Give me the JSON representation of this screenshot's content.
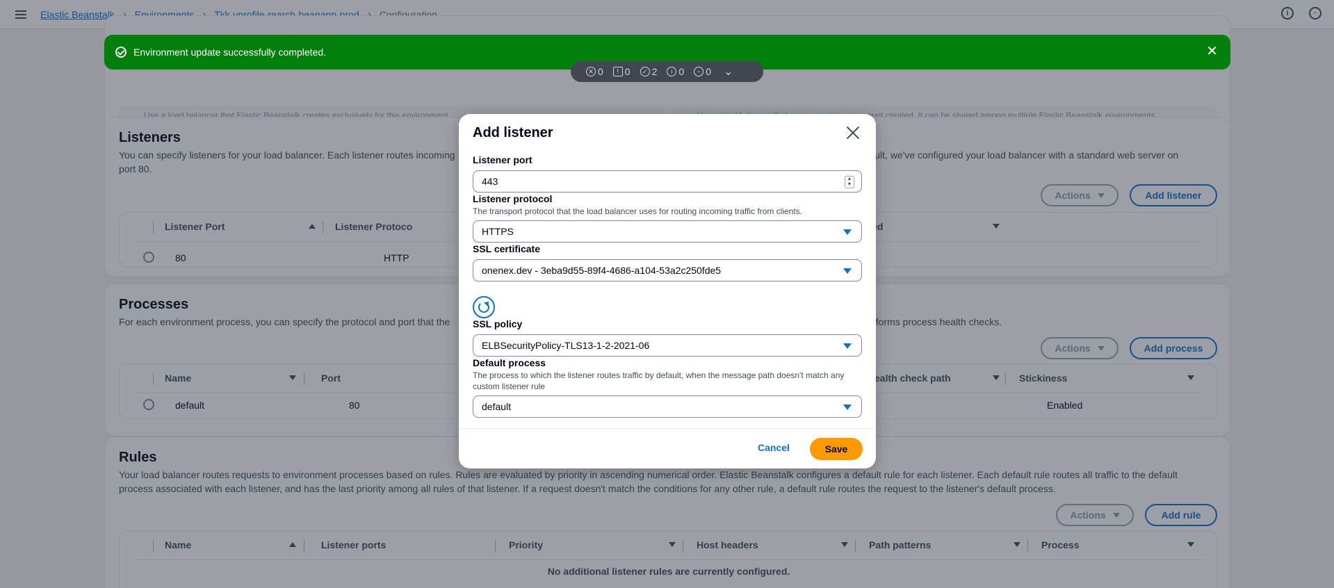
{
  "breadcrumb": {
    "items": [
      "Elastic Beanstalk",
      "Environments",
      "Tkk-vprofile-rearch-beanapp-prod"
    ],
    "current": "Configuration"
  },
  "top_icons": [
    "info-icon",
    "settings-icon"
  ],
  "load_balancer_cards": {
    "dedicated": "Use a load balancer that Elastic Beanstalk creates exclusively for this environment.",
    "shared": "Use a load balancer that someone in your account created. It can be shared among multiple Elastic Beanstalk environments."
  },
  "flash": {
    "message": "Environment update successfully completed.",
    "color": "#037f0c"
  },
  "notification_counts": [
    {
      "icon": "error-icon",
      "count": "0"
    },
    {
      "icon": "warning-icon",
      "count": "0"
    },
    {
      "icon": "success-icon",
      "count": "2"
    },
    {
      "icon": "info-icon",
      "count": "0"
    },
    {
      "icon": "in-progress-icon",
      "count": "0"
    }
  ],
  "listeners": {
    "title": "Listeners",
    "description_left": "You can specify listeners for your load balancer. Each listener routes incoming",
    "description_right": "default, we've configured your load balancer with a standard web server on",
    "description_end": "port 80.",
    "actions_label": "Actions",
    "add_label": "Add listener",
    "columns": [
      "Listener Port",
      "Listener Protoco",
      "Enabled"
    ],
    "rows": [
      {
        "port": "80",
        "protocol": "HTTP"
      }
    ]
  },
  "processes": {
    "title": "Processes",
    "description_left": "For each environment process, you can specify the protocol and port that the",
    "description_right": "r performs process health checks.",
    "actions_label": "Actions",
    "add_label": "Add process",
    "columns": [
      "Name",
      "Port",
      "ealth check path",
      "Stickiness"
    ],
    "rows": [
      {
        "name": "default",
        "port": "80",
        "stickiness": "Enabled"
      }
    ]
  },
  "rules": {
    "title": "Rules",
    "description_line1": "Your load balancer routes requests to environment processes based on rules. Rules are evaluated by priority in ascending numerical order. Elastic Beanstalk configures a default rule for each listener. Each default rule routes all traffic to the default",
    "description_line2": "process associated with each listener, and has the last priority among all rules of that listener. If a request doesn't match the conditions for any other rule, a default rule routes the request to the listener's default process.",
    "actions_label": "Actions",
    "add_label": "Add rule",
    "columns": [
      "Name",
      "Listener ports",
      "Priority",
      "Host headers",
      "Path patterns",
      "Process"
    ],
    "empty": "No additional listener rules are currently configured."
  },
  "modal": {
    "title": "Add listener",
    "listener_port": {
      "label": "Listener port",
      "value": "443"
    },
    "listener_protocol": {
      "label": "Listener protocol",
      "description": "The transport protocol that the load balancer uses for routing incoming traffic from clients.",
      "value": "HTTPS"
    },
    "ssl_certificate": {
      "label": "SSL certificate",
      "value": "onenex.dev - 3eba9d55-89f4-4686-a104-53a2c250fde5"
    },
    "ssl_policy": {
      "label": "SSL policy",
      "value": "ELBSecurityPolicy-TLS13-1-2-2021-06"
    },
    "default_process": {
      "label": "Default process",
      "description": "The process to which the listener routes traffic by default, when the message path doesn't match any custom listener rule",
      "value": "default"
    },
    "cancel_label": "Cancel",
    "save_label": "Save"
  },
  "colors": {
    "accent": "#0972d3",
    "primary_button": "#ff9900",
    "success": "#037f0c"
  }
}
